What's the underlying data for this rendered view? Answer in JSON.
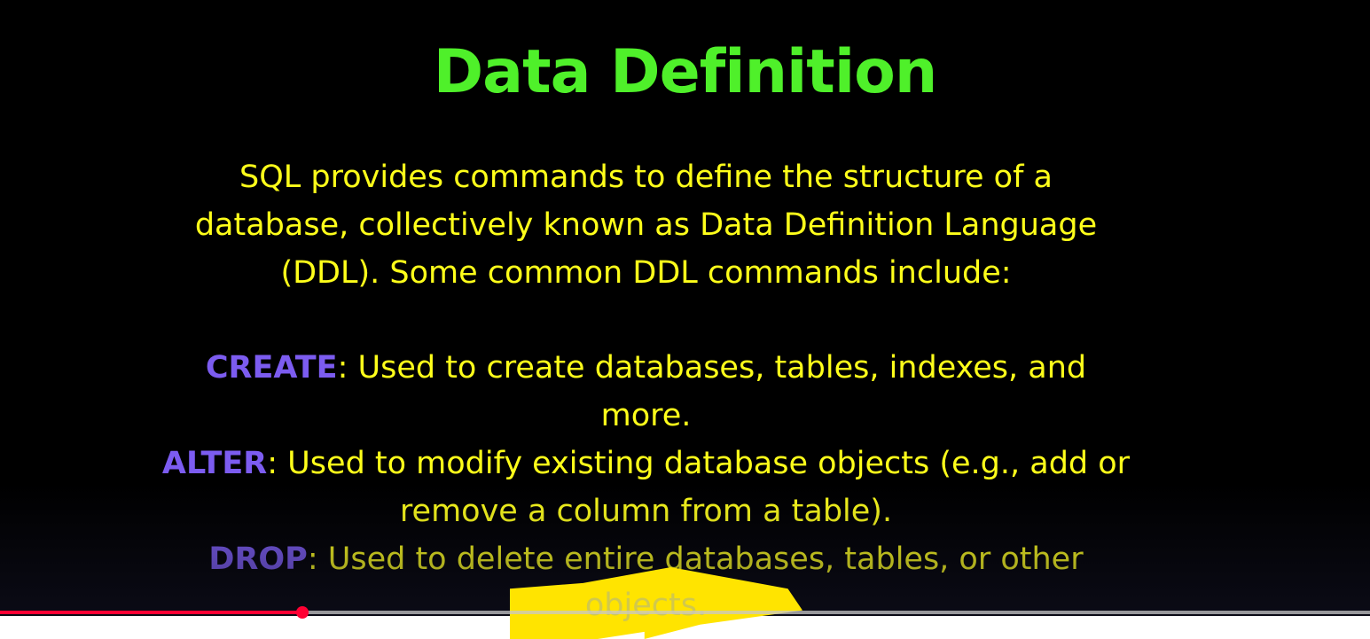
{
  "slide": {
    "title": "Data Definition",
    "intro_lines": [
      "SQL provides commands to define the structure of a",
      "database, collectively known as Data Definition Language",
      "(DDL). Some common DDL commands include:"
    ],
    "commands": [
      {
        "keyword": "CREATE",
        "desc_line1": ": Used to create databases, tables, indexes, and",
        "desc_line2": "more."
      },
      {
        "keyword": "ALTER",
        "desc_line1": ": Used to modify existing database objects (e.g., add or",
        "desc_line2": "remove a column from a table)."
      },
      {
        "keyword": "DROP",
        "desc_line1": ": Used to delete entire databases, tables, or other",
        "desc_line2": "objects."
      }
    ],
    "colors": {
      "title": "#4ff02a",
      "body_text": "#ffff1a",
      "keyword": "#7c5cf0",
      "background": "#000000"
    }
  },
  "player": {
    "progress_fraction": 0.221,
    "progress_color": "#ff0033"
  }
}
